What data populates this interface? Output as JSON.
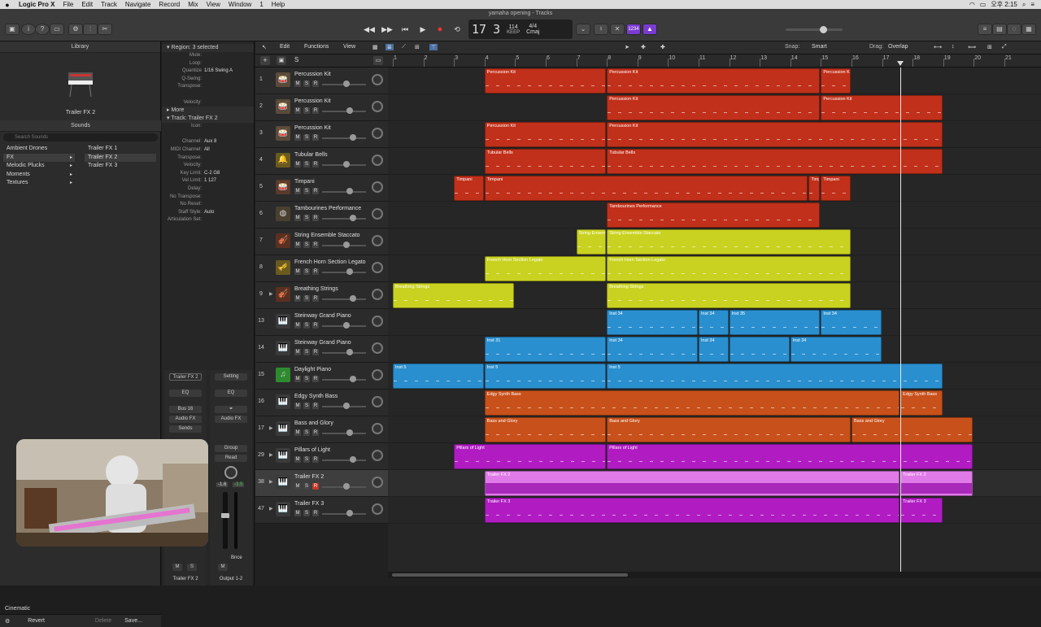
{
  "menubar": {
    "app": "Logic Pro X",
    "items": [
      "File",
      "Edit",
      "Track",
      "Navigate",
      "Record",
      "Mix",
      "View",
      "Window",
      "1",
      "Help"
    ],
    "clock": "오후 2:15"
  },
  "title": "yamaha opening - Tracks",
  "lcd": {
    "bar": "17",
    "beat": "3",
    "bar_lbl": "BAR",
    "beat_lbl": "BEAT",
    "tempo": "114",
    "tempo_lbl": "KEEP",
    "tempo_sub": "TEMPO",
    "sig": "4/4",
    "key": "Cmaj"
  },
  "toolbar": {
    "count_in": "1234"
  },
  "library": {
    "header": "Library",
    "patch": "Trailer FX 2",
    "sounds_header": "Sounds",
    "search_placeholder": "Search Sounds",
    "categories": [
      {
        "label": "Ambient Drones",
        "arrow": false
      },
      {
        "label": "FX",
        "arrow": true,
        "selected": true
      },
      {
        "label": "Melodic Plucks",
        "arrow": true
      },
      {
        "label": "Moments",
        "arrow": true
      },
      {
        "label": "Textures",
        "arrow": true
      }
    ],
    "patches": [
      {
        "label": "Trailer FX 1"
      },
      {
        "label": "Trailer FX 2",
        "selected": true
      },
      {
        "label": "Trailer FX 3"
      }
    ],
    "bank": "Cinematic",
    "revert": "Revert",
    "delete": "Delete",
    "save": "Save..."
  },
  "inspector": {
    "region_hdr": "Region:",
    "region_sel": "3 selected",
    "region_rows": [
      {
        "k": "Mute:",
        "v": ""
      },
      {
        "k": "Loop:",
        "v": ""
      },
      {
        "k": "Quantize",
        "v": "1/16 Swing A"
      },
      {
        "k": "Q-Swing:",
        "v": ""
      },
      {
        "k": "Transpose:",
        "v": ""
      },
      {
        "k": "",
        "v": ""
      },
      {
        "k": "Velocity:",
        "v": ""
      }
    ],
    "more": "More",
    "track_hdr": "Track:",
    "track_name": "Trailer FX 2",
    "track_rows": [
      {
        "k": "Icon:",
        "v": ""
      },
      {
        "k": "",
        "v": ""
      },
      {
        "k": "Channel:",
        "v": "Aux 8"
      },
      {
        "k": "MIDI Channel:",
        "v": "All"
      },
      {
        "k": "Transpose:",
        "v": ""
      },
      {
        "k": "Velocity:",
        "v": ""
      },
      {
        "k": "Key Limit:",
        "v": "C-2  G8"
      },
      {
        "k": "Vel Limit:",
        "v": "1  127"
      },
      {
        "k": "Delay:",
        "v": ""
      },
      {
        "k": "No Transpose:",
        "v": ""
      },
      {
        "k": "No Reset:",
        "v": ""
      },
      {
        "k": "Staff Style:",
        "v": "Auto"
      },
      {
        "k": "Articulation Set:",
        "v": ""
      }
    ]
  },
  "strips": {
    "s1_name": "Trailer FX 2",
    "s2_name": "Output 1-2",
    "setting": "Setting",
    "eq": "EQ",
    "bus": "Bus 16",
    "audio_fx": "Audio FX",
    "sends": "Sends",
    "group": "Group",
    "read": "Read",
    "vol1": "-1.6",
    "vol2": "-3.5",
    "bnce": "Bnce",
    "m": "M",
    "s": "S"
  },
  "trackarea": {
    "edit": "Edit",
    "functions": "Functions",
    "view": "View",
    "snap_lbl": "Snap:",
    "snap": "Smart",
    "drag_lbl": "Drag:",
    "drag": "Overlap"
  },
  "ruler": [
    "1",
    "2",
    "3",
    "4",
    "5",
    "6",
    "7",
    "8",
    "9",
    "10",
    "11",
    "12",
    "13",
    "14",
    "15",
    "16",
    "17",
    "18",
    "19",
    "20",
    "21"
  ],
  "tracks": [
    {
      "num": "1",
      "name": "Percussion Kit",
      "icon": "🥁",
      "ic": "#5a4a3a",
      "disc": false
    },
    {
      "num": "2",
      "name": "Percussion Kit",
      "icon": "🥁",
      "ic": "#5a4a3a",
      "disc": false
    },
    {
      "num": "3",
      "name": "Percussion Kit",
      "icon": "🥁",
      "ic": "#5a4a3a",
      "disc": false
    },
    {
      "num": "4",
      "name": "Tubular Bells",
      "icon": "🔔",
      "ic": "#6a5a20",
      "disc": false
    },
    {
      "num": "5",
      "name": "Timpani",
      "icon": "🥁",
      "ic": "#5a3a2a",
      "disc": false
    },
    {
      "num": "6",
      "name": "Tambourines Performance",
      "icon": "◍",
      "ic": "#4a4030",
      "disc": false
    },
    {
      "num": "7",
      "name": "String Ensemble Staccato",
      "icon": "🎻",
      "ic": "#5a3020",
      "disc": false
    },
    {
      "num": "8",
      "name": "French Horn Section Legato",
      "icon": "🎺",
      "ic": "#6a5a20",
      "disc": false
    },
    {
      "num": "9",
      "name": "Breathing Strings",
      "icon": "🎻",
      "ic": "#5a3020",
      "disc": true
    },
    {
      "num": "13",
      "name": "Steinway Grand Piano",
      "icon": "🎹",
      "ic": "#3a3a3a",
      "disc": false
    },
    {
      "num": "14",
      "name": "Steinway Grand Piano",
      "icon": "🎹",
      "ic": "#3a3a3a",
      "disc": false
    },
    {
      "num": "15",
      "name": "Daylight Piano",
      "icon": "♫",
      "ic": "#2e8a2e",
      "disc": false
    },
    {
      "num": "16",
      "name": "Edgy Synth Bass",
      "icon": "🎹",
      "ic": "#3a3a3a",
      "disc": false
    },
    {
      "num": "17",
      "name": "Bass and Glory",
      "icon": "🎹",
      "ic": "#3a3a3a",
      "disc": true
    },
    {
      "num": "29",
      "name": "Pillars of Light",
      "icon": "🎹",
      "ic": "#3a3a3a",
      "disc": true
    },
    {
      "num": "38",
      "name": "Trailer FX 2",
      "icon": "🎹",
      "ic": "#3a3a3a",
      "disc": true,
      "selected": true,
      "rec": true
    },
    {
      "num": "47",
      "name": "Trailer FX 3",
      "icon": "🎹",
      "ic": "#3a3a3a",
      "disc": true
    }
  ],
  "colors": {
    "red": "#c1301a",
    "yellow": "#c9d220",
    "blue": "#2a8fcf",
    "orange": "#c8501a",
    "magenta": "#b01cc2",
    "pink": "#e07ae8"
  },
  "regions": [
    {
      "lane": 0,
      "s": 4,
      "e": 8,
      "n": "Percussion Kit",
      "c": "red"
    },
    {
      "lane": 0,
      "s": 8,
      "e": 15,
      "n": "Percussion Kit",
      "c": "red"
    },
    {
      "lane": 0,
      "s": 15,
      "e": 16,
      "n": "Percussion K",
      "c": "red"
    },
    {
      "lane": 1,
      "s": 8,
      "e": 15,
      "n": "Percussion Kit",
      "c": "red"
    },
    {
      "lane": 1,
      "s": 15,
      "e": 19,
      "n": "Percussion Kit",
      "c": "red"
    },
    {
      "lane": 2,
      "s": 4,
      "e": 8,
      "n": "Percussion Kit",
      "c": "red"
    },
    {
      "lane": 2,
      "s": 8,
      "e": 19,
      "n": "Percussion Kit",
      "c": "red"
    },
    {
      "lane": 3,
      "s": 4,
      "e": 8,
      "n": "Tubular Bells",
      "c": "red"
    },
    {
      "lane": 3,
      "s": 8,
      "e": 19,
      "n": "Tubular Bells",
      "c": "red"
    },
    {
      "lane": 4,
      "s": 3,
      "e": 4,
      "n": "Timpani",
      "c": "red"
    },
    {
      "lane": 4,
      "s": 4,
      "e": 14.6,
      "n": "Timpani",
      "c": "red"
    },
    {
      "lane": 4,
      "s": 14.6,
      "e": 15,
      "n": "Timpani",
      "c": "red"
    },
    {
      "lane": 4,
      "s": 15,
      "e": 16,
      "n": "Timpani",
      "c": "red"
    },
    {
      "lane": 5,
      "s": 8,
      "e": 15,
      "n": "Tambourines Performance",
      "c": "red"
    },
    {
      "lane": 6,
      "s": 7,
      "e": 8,
      "n": "String Ensem",
      "c": "yellow"
    },
    {
      "lane": 6,
      "s": 8,
      "e": 16,
      "n": "String Ensemble Staccato",
      "c": "yellow"
    },
    {
      "lane": 7,
      "s": 4,
      "e": 8,
      "n": "French Horn Section Legato",
      "c": "yellow"
    },
    {
      "lane": 7,
      "s": 8,
      "e": 16,
      "n": "French Horn Section Legato",
      "c": "yellow"
    },
    {
      "lane": 8,
      "s": 1,
      "e": 5,
      "n": "Breathing Strings",
      "c": "yellow"
    },
    {
      "lane": 8,
      "s": 8,
      "e": 16,
      "n": "Breathing Strings",
      "c": "yellow"
    },
    {
      "lane": 9,
      "s": 8,
      "e": 11,
      "n": "Inst 34",
      "c": "blue"
    },
    {
      "lane": 9,
      "s": 11,
      "e": 12,
      "n": "Inst 34",
      "c": "blue"
    },
    {
      "lane": 9,
      "s": 12,
      "e": 15,
      "n": "Inst 35",
      "c": "blue"
    },
    {
      "lane": 9,
      "s": 15,
      "e": 17,
      "n": "Inst 34",
      "c": "blue"
    },
    {
      "lane": 10,
      "s": 4,
      "e": 8,
      "n": "Inst 31",
      "c": "blue"
    },
    {
      "lane": 10,
      "s": 8,
      "e": 11,
      "n": "Inst 34",
      "c": "blue"
    },
    {
      "lane": 10,
      "s": 11,
      "e": 12,
      "n": "Inst 34",
      "c": "blue"
    },
    {
      "lane": 10,
      "s": 12,
      "e": 14,
      "n": "",
      "c": "blue"
    },
    {
      "lane": 10,
      "s": 14,
      "e": 17,
      "n": "Inst 34",
      "c": "blue"
    },
    {
      "lane": 11,
      "s": 1,
      "e": 4,
      "n": "Inst 5",
      "c": "blue"
    },
    {
      "lane": 11,
      "s": 4,
      "e": 8,
      "n": "Inst 5",
      "c": "blue"
    },
    {
      "lane": 11,
      "s": 8,
      "e": 19,
      "n": "Inst 5",
      "c": "blue"
    },
    {
      "lane": 12,
      "s": 4,
      "e": 17.6,
      "n": "Edgy Synth Bass",
      "c": "orange"
    },
    {
      "lane": 12,
      "s": 17.6,
      "e": 19,
      "n": "Edgy Synth Bass",
      "c": "orange"
    },
    {
      "lane": 13,
      "s": 4,
      "e": 8,
      "n": "Bass and Glory",
      "c": "orange"
    },
    {
      "lane": 13,
      "s": 8,
      "e": 16,
      "n": "Bass and Glory",
      "c": "orange"
    },
    {
      "lane": 13,
      "s": 16,
      "e": 20,
      "n": "Bass and Glory",
      "c": "orange"
    },
    {
      "lane": 14,
      "s": 3,
      "e": 8,
      "n": "Pillars of Light",
      "c": "magenta"
    },
    {
      "lane": 14,
      "s": 8,
      "e": 20,
      "n": "Pillars of Light",
      "c": "magenta"
    },
    {
      "lane": 15,
      "s": 4,
      "e": 17.6,
      "n": "Trailer FX 2",
      "c": "pink"
    },
    {
      "lane": 15,
      "s": 17.6,
      "e": 20,
      "n": "Trailer FX 2",
      "c": "pink"
    },
    {
      "lane": 16,
      "s": 4,
      "e": 17.6,
      "n": "Trailer FX 3",
      "c": "magenta"
    },
    {
      "lane": 16,
      "s": 17.6,
      "e": 19,
      "n": "Trailer FX 3",
      "c": "magenta"
    }
  ],
  "playhead_bar": 17.6
}
